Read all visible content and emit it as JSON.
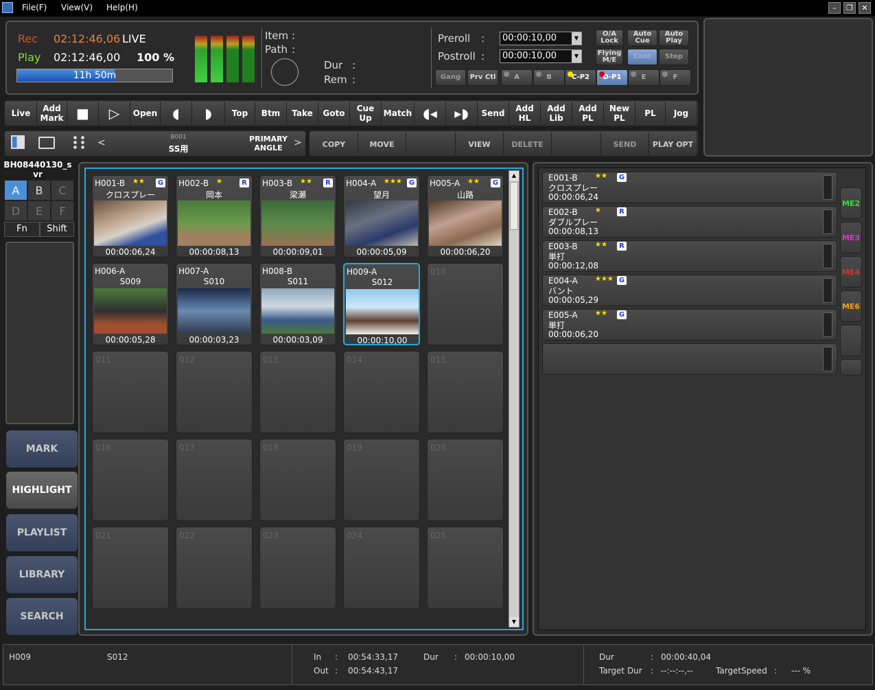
{
  "menu": {
    "file": "File(F)",
    "view": "View(V)",
    "help": "Help(H)"
  },
  "status": {
    "rec_label": "Rec",
    "rec_tc": "02:12:46,06",
    "live": "LIVE",
    "play_label": "Play",
    "play_tc": "02:12:46,00",
    "percent": "100 %",
    "remaining": "11h 50m"
  },
  "info": {
    "item_label": "Item",
    "path_label": "Path",
    "dur_label": "Dur",
    "rem_label": "Rem",
    "colon": ":"
  },
  "prepost": {
    "preroll_label": "Preroll",
    "preroll": "00:00:10,00",
    "postroll_label": "Postroll",
    "postroll": "00:00:10,00"
  },
  "mode_buttons": {
    "oa_lock": "O/A Lock",
    "auto_cue": "Auto Cue",
    "auto_play": "Auto Play",
    "flying_me": "Flying M/E",
    "cont": "Cont",
    "step": "Step",
    "gang": "Gang",
    "prv_ctl": "Prv Ctl"
  },
  "channels": [
    "A",
    "B",
    "C-P2",
    "D-P1",
    "E",
    "F"
  ],
  "toolbar": [
    "Live",
    "Add Mark",
    "",
    "",
    "Open",
    "",
    "",
    "Top",
    "Btm",
    "Take",
    "Goto",
    "Cue Up",
    "Match",
    "",
    "",
    "Send",
    "Add HL",
    "Add Lib",
    "Add PL",
    "New PL",
    "PL",
    "Jog"
  ],
  "browser": {
    "prev": "<",
    "next": ">",
    "bin_id": "B001",
    "bin_name": "SS用",
    "angle": "PRIMARY ANGLE"
  },
  "actions": [
    "COPY",
    "MOVE",
    "",
    "VIEW",
    "DELETE",
    "",
    "SEND",
    "PLAY OPT"
  ],
  "clip_name": "BH08440130_svr",
  "keys": [
    "A",
    "B",
    "C",
    "D",
    "E",
    "F"
  ],
  "fn": "Fn",
  "shift": "Shift",
  "nav": [
    "MARK",
    "HIGHLIGHT",
    "PLAYLIST",
    "LIBRARY",
    "SEARCH"
  ],
  "clips": [
    {
      "id": "H001-B",
      "stars": "★★",
      "badge": "G",
      "name": "クロスプレー",
      "dur": "00:00:06,24"
    },
    {
      "id": "H002-B",
      "stars": "★",
      "badge": "R",
      "name": "岡本",
      "dur": "00:00:08,13"
    },
    {
      "id": "H003-B",
      "stars": "★★",
      "badge": "R",
      "name": "梁瀬",
      "dur": "00:00:09,01"
    },
    {
      "id": "H004-A",
      "stars": "★★★",
      "badge": "G",
      "name": "望月",
      "dur": "00:00:05,09"
    },
    {
      "id": "H005-A",
      "stars": "★★",
      "badge": "G",
      "name": "山路",
      "dur": "00:00:06,20"
    },
    {
      "id": "H006-A",
      "stars": "",
      "badge": "",
      "name": "S009",
      "dur": "00:00:05,28"
    },
    {
      "id": "H007-A",
      "stars": "",
      "badge": "",
      "name": "S010",
      "dur": "00:00:03,23"
    },
    {
      "id": "H008-B",
      "stars": "",
      "badge": "",
      "name": "S011",
      "dur": "00:00:03,09"
    },
    {
      "id": "H009-A",
      "stars": "",
      "badge": "",
      "name": "S012",
      "dur": "00:00:10,00"
    }
  ],
  "empty_slots": [
    "010",
    "011",
    "012",
    "013",
    "014",
    "015",
    "016",
    "017",
    "018",
    "019",
    "020",
    "021",
    "022",
    "023",
    "024",
    "025"
  ],
  "highlights": [
    {
      "id": "E001-B",
      "stars": "★★",
      "badge": "G",
      "name": "クロスプレー",
      "dur": "00:00:06,24"
    },
    {
      "id": "E002-B",
      "stars": "★",
      "badge": "R",
      "name": "ダブルプレー",
      "dur": "00:00:08,13"
    },
    {
      "id": "E003-B",
      "stars": "★★",
      "badge": "R",
      "name": "単打",
      "dur": "00:00:12,08"
    },
    {
      "id": "E004-A",
      "stars": "★★★",
      "badge": "G",
      "name": "バント",
      "dur": "00:00:05,29"
    },
    {
      "id": "E005-A",
      "stars": "★★",
      "badge": "G",
      "name": "単打",
      "dur": "00:00:06,20"
    }
  ],
  "me_tabs": [
    {
      "label": "ME2",
      "color": "#30e030"
    },
    {
      "label": "ME3",
      "color": "#e030e0"
    },
    {
      "label": "ME4",
      "color": "#e03030"
    },
    {
      "label": "ME6",
      "color": "#f0a020"
    }
  ],
  "footer": {
    "clip": "H009",
    "scene": "S012",
    "in_label": "In",
    "in": "00:54:33,17",
    "out_label": "Out",
    "out": "00:54:43,17",
    "dur_label": "Dur",
    "dur": "00:00:10,00",
    "total_dur_label": "Dur",
    "total_dur": "00:00:40,04",
    "target_dur_label": "Target Dur",
    "target_dur": "--:--:--,--",
    "target_speed_label": "TargetSpeed",
    "target_speed": "--- %",
    "colon": ":"
  }
}
